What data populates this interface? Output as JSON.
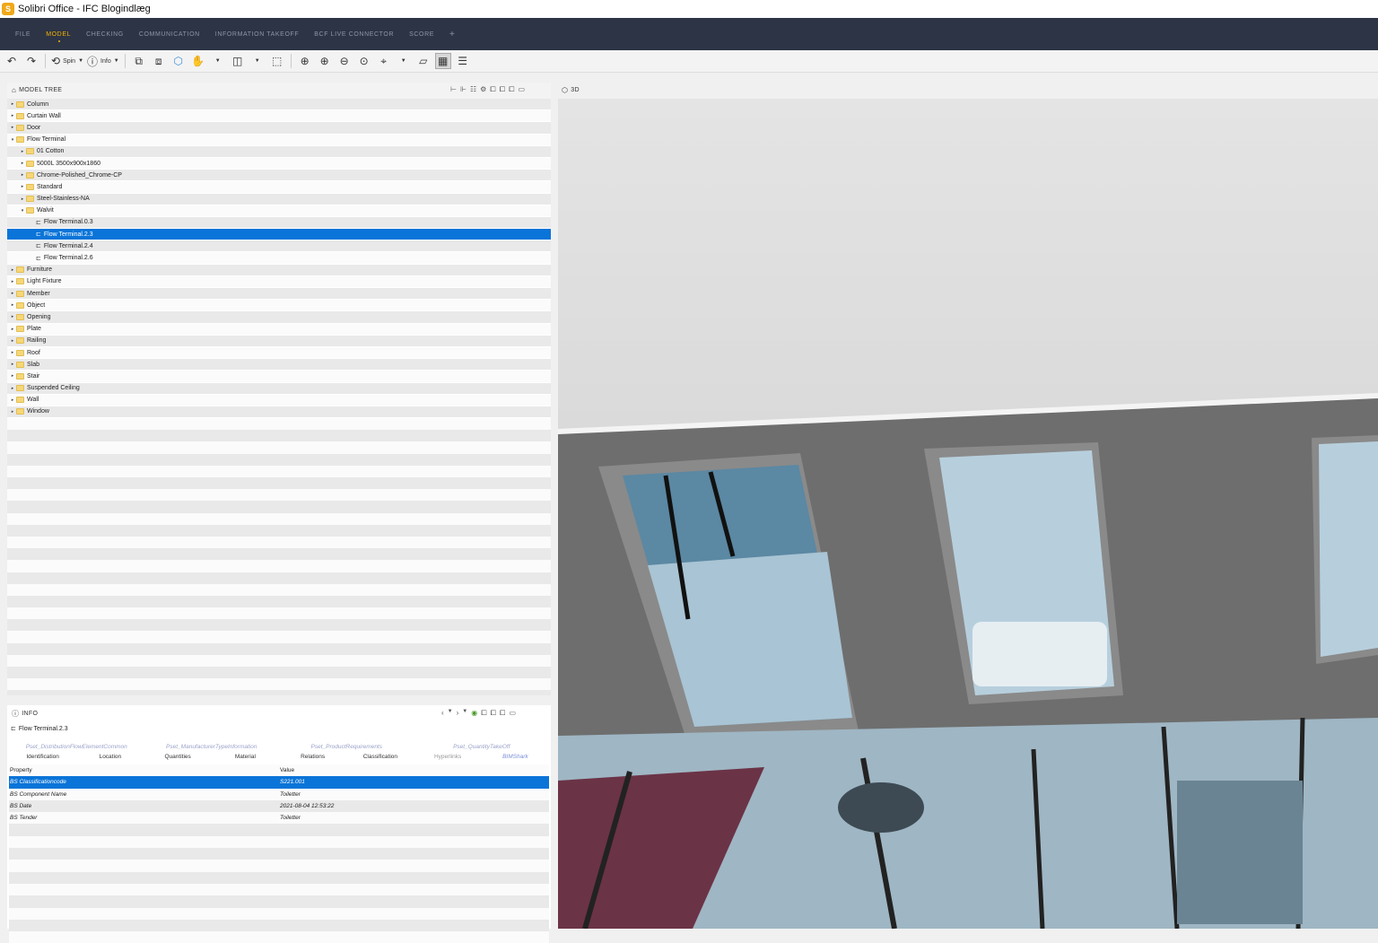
{
  "window": {
    "title": "Solibri Office - IFC Blogindlæg",
    "app_icon": "solibri-logo-icon"
  },
  "menu": {
    "items": [
      "FILE",
      "MODEL",
      "CHECKING",
      "COMMUNICATION",
      "INFORMATION TAKEOFF",
      "BCF LIVE CONNECTOR",
      "SCORE"
    ],
    "active": "MODEL",
    "plus": "+"
  },
  "toolbar": {
    "spin_label": "Spin",
    "info_label": "Info"
  },
  "model_tree": {
    "title": "MODEL TREE",
    "rows": [
      {
        "label": "Column",
        "level": 0,
        "type": "folder",
        "arrow": "▸"
      },
      {
        "label": "Curtain Wall",
        "level": 0,
        "type": "folder",
        "arrow": "▸"
      },
      {
        "label": "Door",
        "level": 0,
        "type": "folder",
        "arrow": "▸"
      },
      {
        "label": "Flow Terminal",
        "level": 0,
        "type": "folder",
        "arrow": "▾"
      },
      {
        "label": "01 Cotton",
        "level": 1,
        "type": "folder",
        "arrow": "▸"
      },
      {
        "label": "5000L 3500x900x1860",
        "level": 1,
        "type": "folder",
        "arrow": "▸"
      },
      {
        "label": "Chrome-Polished_Chrome-CP",
        "level": 1,
        "type": "folder",
        "arrow": "▸"
      },
      {
        "label": "Standard",
        "level": 1,
        "type": "folder",
        "arrow": "▸"
      },
      {
        "label": "Steel-Stainless-NA",
        "level": 1,
        "type": "folder",
        "arrow": "▸"
      },
      {
        "label": "Walvit",
        "level": 1,
        "type": "folder",
        "arrow": "▾"
      },
      {
        "label": "Flow Terminal.0.3",
        "level": 2,
        "type": "element",
        "arrow": ""
      },
      {
        "label": "Flow Terminal.2.3",
        "level": 2,
        "type": "element",
        "arrow": "",
        "selected": true
      },
      {
        "label": "Flow Terminal.2.4",
        "level": 2,
        "type": "element",
        "arrow": ""
      },
      {
        "label": "Flow Terminal.2.6",
        "level": 2,
        "type": "element",
        "arrow": ""
      },
      {
        "label": "Furniture",
        "level": 0,
        "type": "folder",
        "arrow": "▸"
      },
      {
        "label": "Light Fixture",
        "level": 0,
        "type": "folder",
        "arrow": "▸"
      },
      {
        "label": "Member",
        "level": 0,
        "type": "folder",
        "arrow": "▸"
      },
      {
        "label": "Object",
        "level": 0,
        "type": "folder",
        "arrow": "▸"
      },
      {
        "label": "Opening",
        "level": 0,
        "type": "folder",
        "arrow": "▸"
      },
      {
        "label": "Plate",
        "level": 0,
        "type": "folder",
        "arrow": "▸"
      },
      {
        "label": "Railing",
        "level": 0,
        "type": "folder",
        "arrow": "▸"
      },
      {
        "label": "Roof",
        "level": 0,
        "type": "folder",
        "arrow": "▸"
      },
      {
        "label": "Slab",
        "level": 0,
        "type": "folder",
        "arrow": "▸"
      },
      {
        "label": "Stair",
        "level": 0,
        "type": "folder",
        "arrow": "▸"
      },
      {
        "label": "Suspended Ceiling",
        "level": 0,
        "type": "folder",
        "arrow": "▸"
      },
      {
        "label": "Wall",
        "level": 0,
        "type": "folder",
        "arrow": "▸"
      },
      {
        "label": "Window",
        "level": 0,
        "type": "folder",
        "arrow": "▸"
      }
    ]
  },
  "viewport": {
    "title": "3D"
  },
  "info": {
    "title": "INFO",
    "selected_element": "Flow Terminal.2.3",
    "tabs_row1": [
      "Pset_DistributionFlowElementCommon",
      "Pset_ManufacturerTypeInformation",
      "Pset_ProductRequirements",
      "Pset_QuantityTakeOff"
    ],
    "tabs_row2": [
      "Identification",
      "Location",
      "Quantities",
      "Material",
      "Relations",
      "Classification",
      "Hyperlinks",
      "BIMShark"
    ],
    "active_tab": "BIMShark",
    "columns": {
      "property": "Property",
      "value": "Value"
    },
    "rows": [
      {
        "property": "BS Classificationcode",
        "value": "S221.001",
        "selected": true
      },
      {
        "property": "BS Component Name",
        "value": "Toiletter"
      },
      {
        "property": "BS Date",
        "value": "2021-08-04 12:53:22"
      },
      {
        "property": "BS Tender",
        "value": "Toiletter"
      }
    ]
  },
  "colors": {
    "menubar": "#2d3446",
    "accent": "#f0b400",
    "selection": "#0a74d8"
  }
}
